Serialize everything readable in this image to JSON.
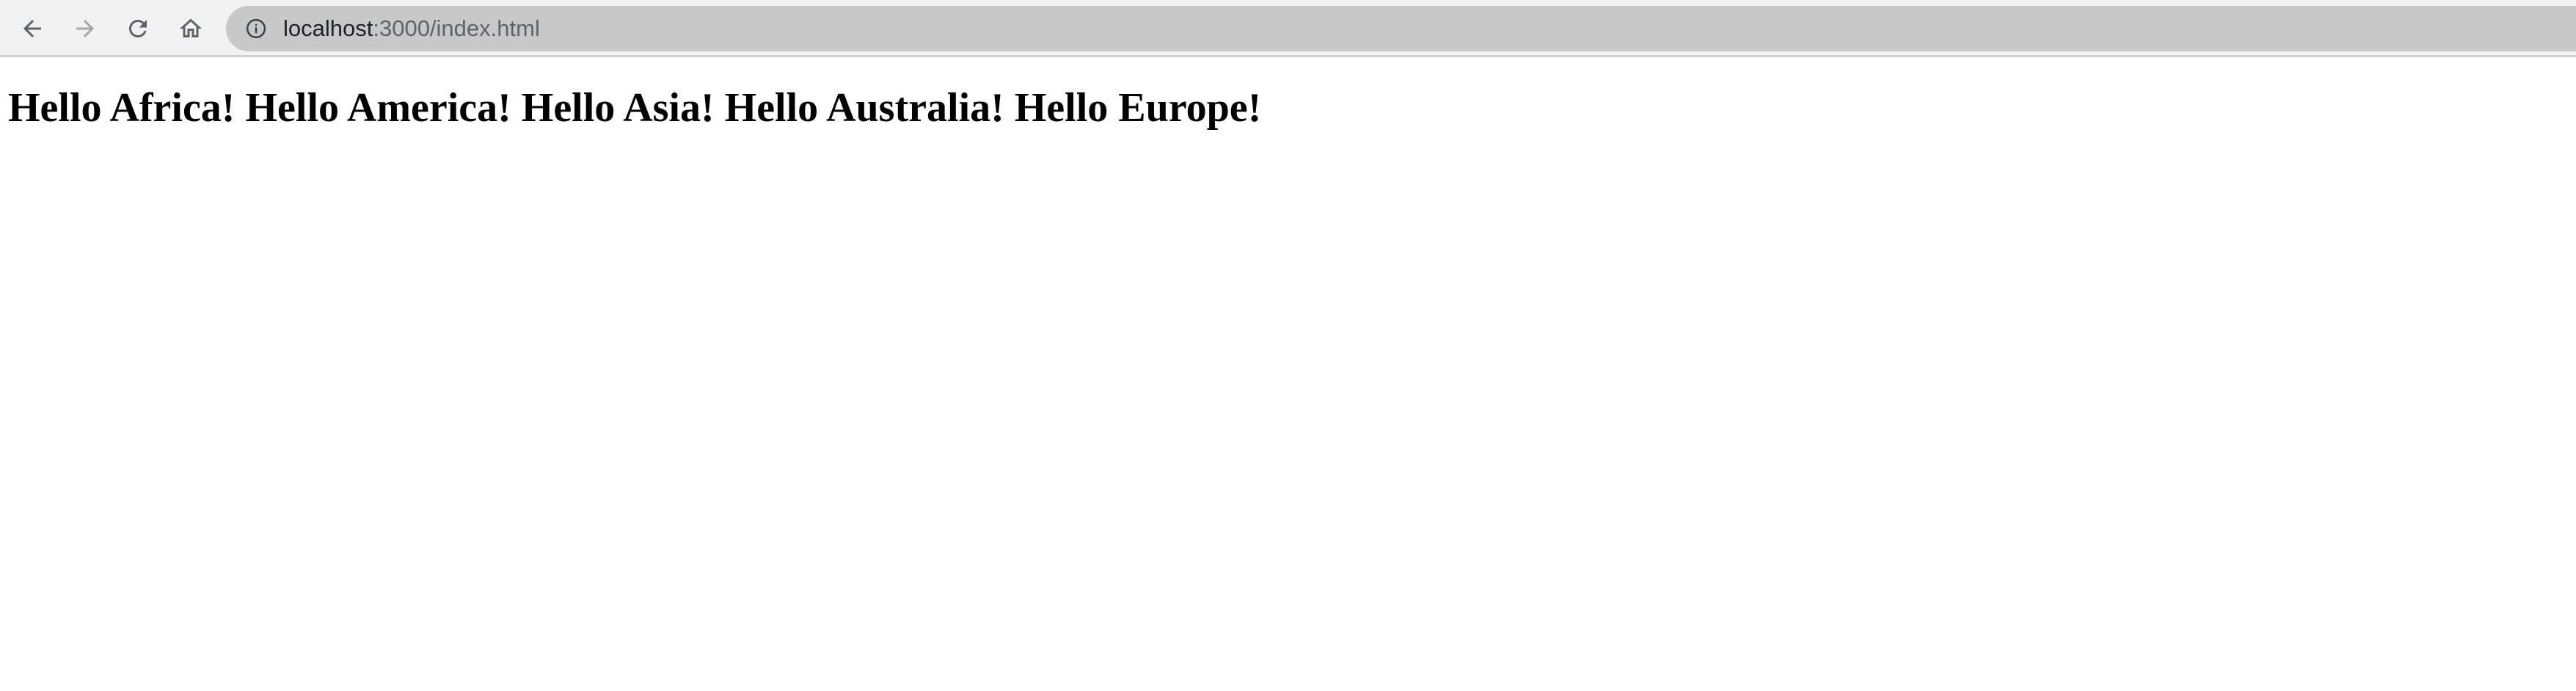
{
  "browser": {
    "url_host": "localhost",
    "url_path": ":3000/index.html",
    "buttons": {
      "back_icon": "arrow-left-icon",
      "forward_icon": "arrow-right-icon",
      "reload_icon": "reload-icon",
      "home_icon": "home-icon",
      "site_info_icon": "info-circle-icon"
    },
    "colors": {
      "toolbar_bg": "#f1f1f1",
      "address_bar_bg": "#c8c8c8",
      "icon_active": "#5f6368",
      "icon_disabled": "#a6a6a6"
    }
  },
  "page": {
    "heading": "Hello Africa! Hello America! Hello Asia! Hello Australia! Hello Europe!"
  }
}
